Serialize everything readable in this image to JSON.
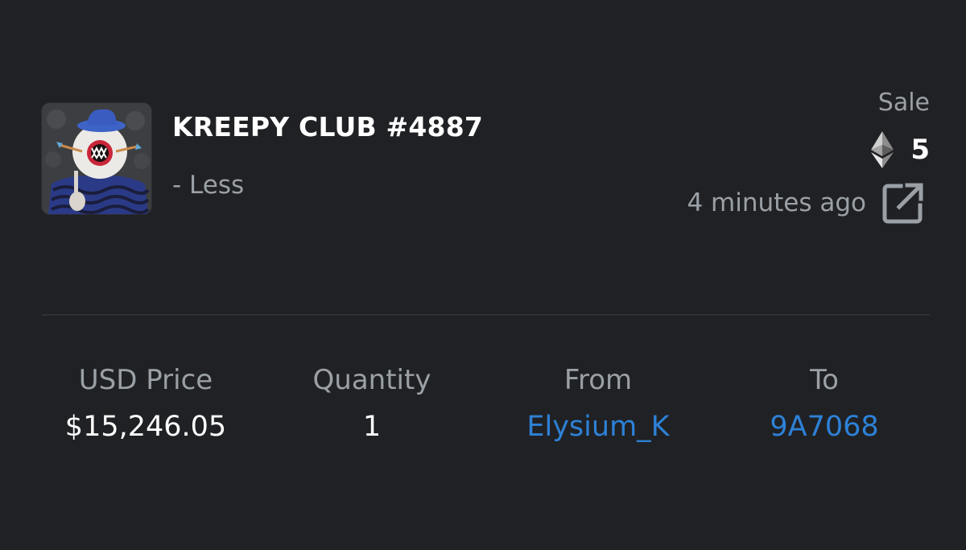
{
  "item": {
    "title": "KREEPY CLUB #4887",
    "toggle_label": "- Less",
    "thumbnail_icon": "nft-thumbnail-image"
  },
  "event": {
    "type": "Sale",
    "currency_icon": "ethereum-icon",
    "amount": "5",
    "time_ago": "4 minutes ago",
    "link_icon": "external-link-icon"
  },
  "stats": {
    "usd_price_label": "USD Price",
    "usd_price_value": "$15,246.05",
    "quantity_label": "Quantity",
    "quantity_value": "1",
    "from_label": "From",
    "from_value": "Elysium_K",
    "to_label": "To",
    "to_value": "9A7068"
  },
  "colors": {
    "background": "#202124",
    "text_primary": "#ffffff",
    "text_secondary": "#9aa0a6",
    "link": "#2d81d6",
    "divider": "#2e3035"
  }
}
